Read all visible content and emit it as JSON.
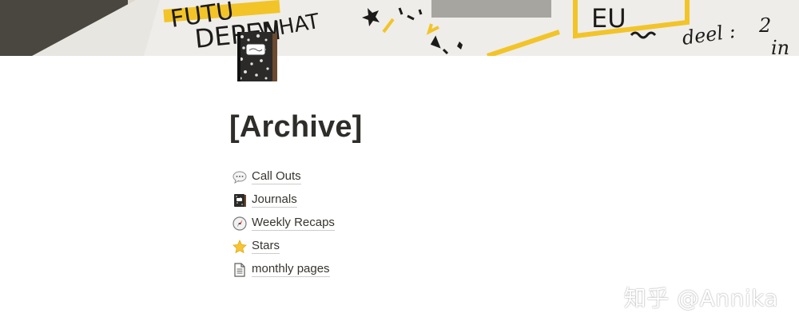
{
  "page": {
    "title": "[Archive]",
    "cover_texts": [
      "FUTU",
      "DEPEN",
      "WHAT",
      "EU",
      "deel :",
      "2",
      "in"
    ]
  },
  "items": [
    {
      "label": "Call Outs",
      "icon": "speech-bubble-icon"
    },
    {
      "label": "Journals",
      "icon": "notebook-icon"
    },
    {
      "label": "Weekly Recaps",
      "icon": "compass-icon"
    },
    {
      "label": "Stars",
      "icon": "star-icon"
    },
    {
      "label": "monthly pages",
      "icon": "page-icon"
    }
  ],
  "watermark": "知乎 @Annika",
  "colors": {
    "text": "#37352f",
    "accent_yellow": "#f2c428",
    "background": "#ffffff"
  }
}
